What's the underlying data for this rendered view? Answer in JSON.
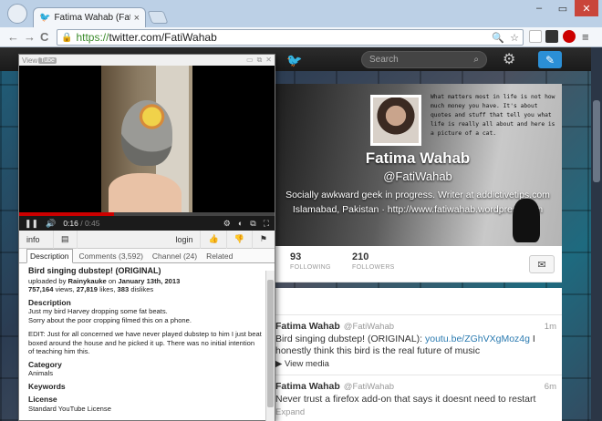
{
  "browser": {
    "tab_title": "Fatima Wahab (FatiWaha...",
    "tab_close": "×",
    "url_scheme": "https://",
    "url_rest": "twitter.com/FatiWahab",
    "win_min": "–",
    "win_max": "▭",
    "win_close": "✕",
    "back": "←",
    "forward": "→",
    "reload": "C"
  },
  "twitter": {
    "search_placeholder": "Search",
    "profile": {
      "name": "Fatima Wahab",
      "handle": "@FatiWahab",
      "bio": "Socially awkward geek in progress. Writer at addictivetips.com",
      "location": "Islamabad, Pakistan",
      "separator": "·",
      "website": "http://www.fatiwahab.wordpress.com",
      "quote": "What matters most in life is not how much money you have. It's about quotes and stuff that tell you what life is really all about and here is a picture of a cat."
    },
    "stats": [
      {
        "value": "93",
        "label": "FOLLOWING"
      },
      {
        "value": "210",
        "label": "FOLLOWERS"
      }
    ],
    "tweets": [
      {
        "name": "Fatima Wahab",
        "handle": "@FatiWahab",
        "time": "1m",
        "text_before": "Bird singing dubstep! (ORIGINAL): ",
        "link": "youtu.be/ZGhVXgMoz4g",
        "text_after": " I honestly think this bird is the real future of music",
        "action": "View media"
      },
      {
        "name": "Fatima Wahab",
        "handle": "@FatiWahab",
        "time": "6m",
        "text": "Never trust a firefox add-on that says it doesnt need to restart",
        "action": "Expand"
      }
    ]
  },
  "viewtube": {
    "title_prefix": "View",
    "title_logo": "Tube",
    "time_current": "0:16",
    "time_total": "/ 0:45",
    "progress": 0.37,
    "bar": {
      "info": "info",
      "login": "login"
    },
    "tabs": [
      "Description",
      "Comments (3,592)",
      "Channel (24)",
      "Related"
    ],
    "video_title": "Bird singing dubstep! (ORIGINAL)",
    "uploaded_prefix": "uploaded by ",
    "uploader": "Rainykauke",
    "uploaded_on": " on ",
    "upload_date": "January 13th, 2013",
    "views": "757,164",
    "views_label": " views, ",
    "likes": "27,819",
    "likes_label": " likes, ",
    "dislikes": "383",
    "dislikes_label": " dislikes",
    "desc_heading": "Description",
    "desc_line1": "Just my bird Harvey dropping some fat beats.",
    "desc_line2": "Sorry about the poor cropping filmed this on a phone.",
    "desc_edit": "EDIT: Just for all concerned we have never played dubstep to him I just beat boxed around the house and he picked it up. There was no initial intention of teaching him this.",
    "category_heading": "Category",
    "category": "Animals",
    "keywords_heading": "Keywords",
    "license_heading": "License",
    "license": "Standard YouTube License"
  }
}
